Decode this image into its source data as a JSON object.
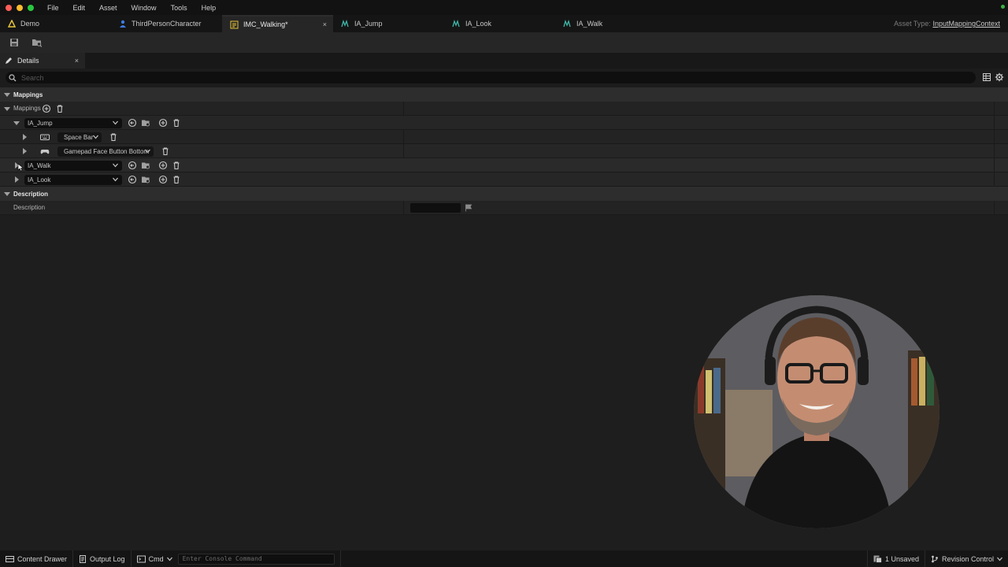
{
  "menubar": {
    "items": [
      "File",
      "Edit",
      "Asset",
      "Window",
      "Tools",
      "Help"
    ],
    "traffic_colors": [
      "#ff5f57",
      "#febc2e",
      "#28c840"
    ]
  },
  "tabs": [
    {
      "label": "Demo",
      "icon": "ue-project-icon"
    },
    {
      "label": "ThirdPersonCharacter",
      "icon": "person-icon"
    },
    {
      "label": "IMC_Walking*",
      "icon": "input-mapping-icon",
      "active": true
    },
    {
      "label": "IA_Jump",
      "icon": "input-action-icon"
    },
    {
      "label": "IA_Look",
      "icon": "input-action-icon"
    },
    {
      "label": "IA_Walk",
      "icon": "input-action-icon"
    }
  ],
  "tab_close": "×",
  "asset_type": {
    "prefix": "Asset Type:",
    "value": "InputMappingContext"
  },
  "details_panel": {
    "title": "Details",
    "close": "×"
  },
  "search": {
    "placeholder": "Search"
  },
  "mappings_section": {
    "header": "Mappings",
    "mappings_label": "Mappings",
    "entries": [
      {
        "action": "IA_Jump",
        "expanded": true,
        "keys": [
          "Space Bar",
          "Gamepad Face Button Bottom"
        ]
      },
      {
        "action": "IA_Walk",
        "expanded": false
      },
      {
        "action": "IA_Look",
        "expanded": false
      }
    ]
  },
  "description_section": {
    "header": "Description",
    "label": "Description"
  },
  "bottombar": {
    "content_drawer": "Content Drawer",
    "output_log": "Output Log",
    "cmd": "Cmd",
    "console_placeholder": "Enter Console Command",
    "unsaved": "1 Unsaved",
    "revision_control": "Revision Control"
  },
  "colors": {
    "accent_yellow": "#e8c53a",
    "accent_teal": "#3fb8a9",
    "accent_blue": "#3d7be0"
  }
}
